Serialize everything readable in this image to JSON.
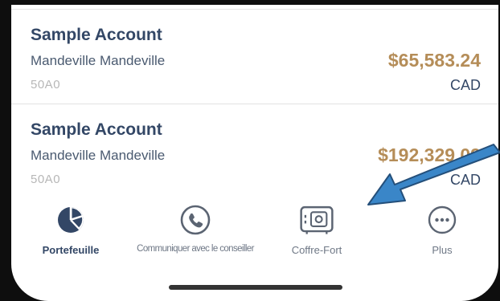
{
  "accounts": [
    {
      "name": "Sample Account",
      "holder": "Mandeville Mandeville",
      "number": "50A0",
      "balance": "$65,583.24",
      "currency": "CAD"
    },
    {
      "name": "Sample Account",
      "holder": "Mandeville Mandeville",
      "number": "50A0",
      "balance": "$192,329.09",
      "currency": "CAD"
    }
  ],
  "tabbar": {
    "tabs": [
      {
        "label": "Portefeuille",
        "icon": "pie-chart-icon",
        "active": true
      },
      {
        "label": "Communiquer avec le conseiller",
        "icon": "phone-icon",
        "active": false
      },
      {
        "label": "Coffre-Fort",
        "icon": "safe-icon",
        "active": false
      },
      {
        "label": "Plus",
        "icon": "more-icon",
        "active": false
      }
    ]
  },
  "colors": {
    "primary": "#334766",
    "balance": "#b58d58",
    "muted": "#6f7886",
    "annotation_arrow": "#3a86c8"
  }
}
